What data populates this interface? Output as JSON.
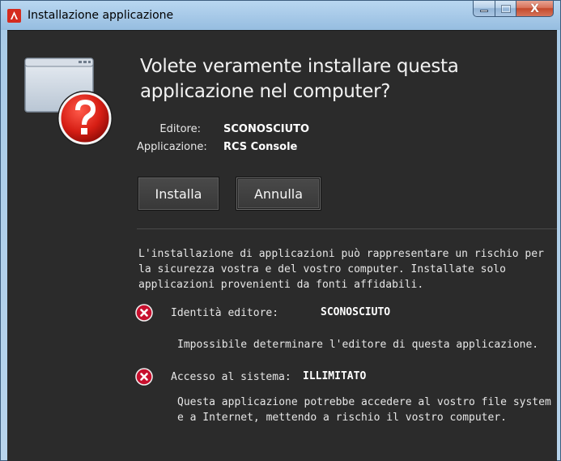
{
  "window": {
    "title": "Installazione applicazione",
    "caption_close": "X"
  },
  "dialog": {
    "heading": "Volete veramente installare questa applicazione nel computer?",
    "publisher_label": "Editore:",
    "publisher_value": "SCONOSCIUTO",
    "application_label": "Applicazione:",
    "application_value": "RCS Console",
    "install_button": "Installa",
    "cancel_button": "Annulla",
    "warning_text": "L'installazione di applicazioni può rappresentare un rischio per la sicurezza vostra e del vostro computer. Installate solo applicazioni provenienti da fonti affidabili.",
    "risks": [
      {
        "label": "Identità editore:",
        "value": "SCONOSCIUTO",
        "description": "Impossibile determinare l'editore di questa applicazione.",
        "icon": "error-x-icon"
      },
      {
        "label": "Accesso al sistema:",
        "value": "ILLIMITATO",
        "description": "Questa applicazione potrebbe accedere al vostro file system e a Internet, mettendo a rischio il vostro computer.",
        "icon": "error-x-icon"
      }
    ]
  },
  "colors": {
    "background": "#2b2b2b",
    "text": "#e6e6e6",
    "error_red": "#c8102e",
    "titlebar": "#a9cbe9"
  }
}
